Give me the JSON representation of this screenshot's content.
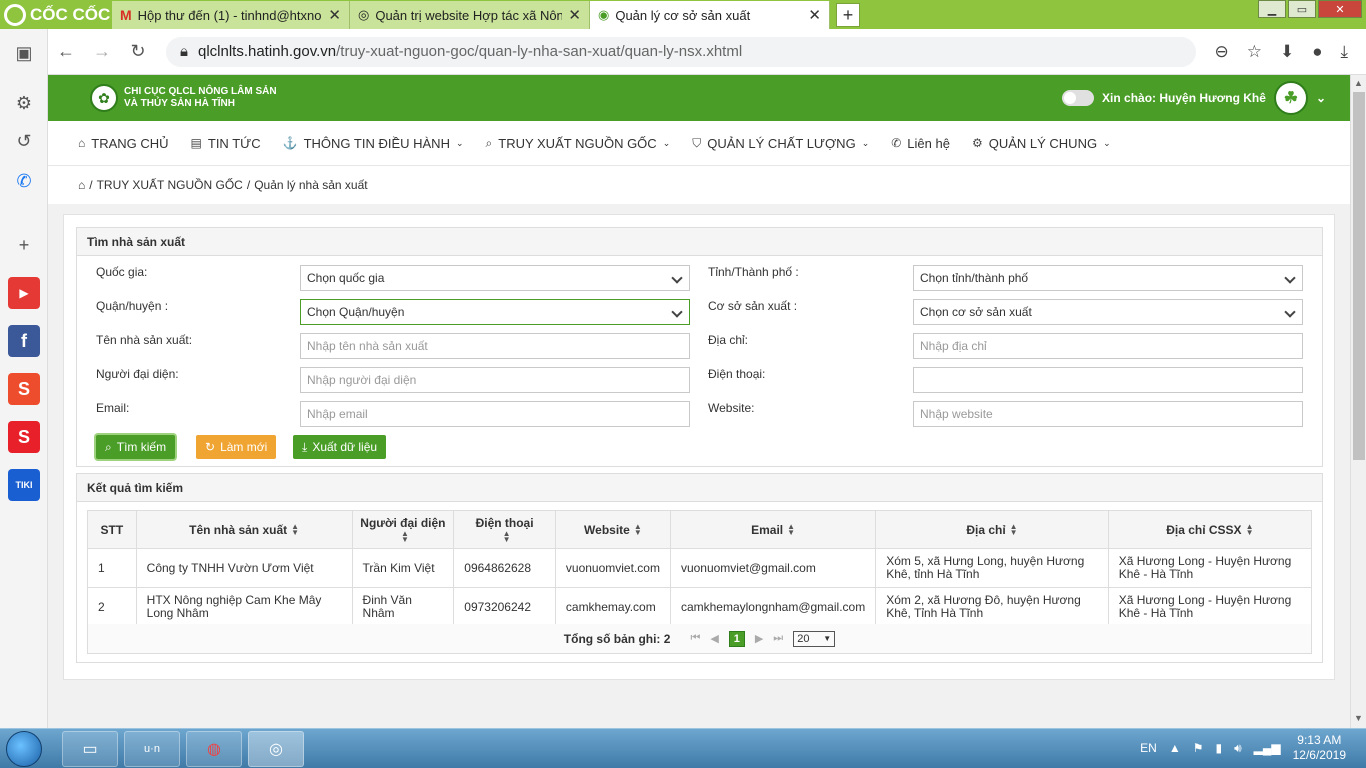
{
  "browser": {
    "brand": "CỐC CỐC",
    "tabs": [
      {
        "title": "Hộp thư đến (1) - tinhnd@htxnong",
        "icon": "gmail-icon"
      },
      {
        "title": "Quản trị website Hợp tác xã Nông",
        "icon": "globe-icon"
      },
      {
        "title": "Quản lý cơ sở sản xuất",
        "icon": "site-icon"
      }
    ],
    "url_host": "qlclnlts.hatinh.gov.vn",
    "url_path": "/truy-xuat-nguon-goc/quan-ly-nha-san-xuat/quan-ly-nsx.xhtml"
  },
  "site": {
    "name_line1": "CHI CỤC QLCL NÔNG LÂM SẢN",
    "name_line2": "VÀ THỦY SẢN HÀ TĨNH",
    "greeting": "Xin chào: Huyện Hương Khê"
  },
  "menu": [
    {
      "label": "TRANG CHỦ",
      "icon": "home-icon",
      "dropdown": false
    },
    {
      "label": "TIN TỨC",
      "icon": "news-icon",
      "dropdown": false
    },
    {
      "label": "THÔNG TIN ĐIỀU HÀNH",
      "icon": "anchor-icon",
      "dropdown": true
    },
    {
      "label": "TRUY XUẤT NGUỒN GỐC",
      "icon": "search-icon",
      "dropdown": true
    },
    {
      "label": "QUẢN LÝ CHẤT LƯỢNG",
      "icon": "shield-icon",
      "dropdown": true
    },
    {
      "label": "Liên hệ",
      "icon": "phone-icon",
      "dropdown": false
    },
    {
      "label": "QUẢN LÝ CHUNG",
      "icon": "gear-icon",
      "dropdown": true
    }
  ],
  "breadcrumb": {
    "section": "TRUY XUẤT NGUỒN GỐC",
    "page": "Quản lý nhà sản xuất",
    "sep": "/"
  },
  "search": {
    "title": "Tìm nhà sản xuất",
    "fields": {
      "country": {
        "label": "Quốc gia:",
        "value": "Chọn quốc gia"
      },
      "province": {
        "label": "Tỉnh/Thành phố :",
        "value": "Chọn tỉnh/thành phố"
      },
      "district": {
        "label": "Quận/huyện :",
        "value": "Chọn Quận/huyện"
      },
      "facility": {
        "label": "Cơ sở sản xuất :",
        "value": "Chọn cơ sở sản xuất"
      },
      "name": {
        "label": "Tên nhà sản xuất:",
        "placeholder": "Nhập tên nhà sản xuất"
      },
      "address": {
        "label": "Địa chỉ:",
        "placeholder": "Nhập địa chỉ"
      },
      "rep": {
        "label": "Người đại diện:",
        "placeholder": "Nhập người đại diện"
      },
      "phone": {
        "label": "Điện thoại:",
        "placeholder": ""
      },
      "email": {
        "label": "Email:",
        "placeholder": "Nhập email"
      },
      "website": {
        "label": "Website:",
        "placeholder": "Nhập website"
      }
    },
    "buttons": {
      "search": "Tìm kiếm",
      "reset": "Làm mới",
      "export": "Xuất dữ liệu"
    }
  },
  "results": {
    "title": "Kết quả tìm kiếm",
    "columns": [
      "STT",
      "Tên nhà sản xuất",
      "Người đại diện",
      "Điện thoại",
      "Website",
      "Email",
      "Địa chỉ",
      "Địa chỉ CSSX"
    ],
    "rows": [
      [
        "1",
        "Công ty TNHH Vườn Ươm Việt",
        "Trần Kim Việt",
        "0964862628",
        "vuonuomviet.com",
        "vuonuomviet@gmail.com",
        "Xóm 5, xã Hưng Long, huyện Hương Khê, tỉnh Hà Tĩnh",
        "Xã Hương Long - Huyện Hương Khê - Hà Tĩnh"
      ],
      [
        "2",
        "HTX Nông nghiệp Cam Khe Mây Long Nhâm",
        "Đinh Văn Nhâm",
        "0973206242",
        "camkhemay.com",
        "camkhemaylongnham@gmail.com",
        "Xóm 2, xã Hương Đô, huyện Hương Khê, Tỉnh Hà Tĩnh",
        "Xã Hương Long - Huyện Hương Khê - Hà Tĩnh"
      ]
    ],
    "total_label": "Tổng số bản ghi: 2",
    "current_page": "1",
    "page_size": "20"
  },
  "taskbar": {
    "lang": "EN",
    "time": "9:13 AM",
    "date": "12/6/2019"
  },
  "colors": {
    "brand_green": "#4a9d27",
    "browser_green": "#8fc43f",
    "button_orange": "#f0a431"
  }
}
